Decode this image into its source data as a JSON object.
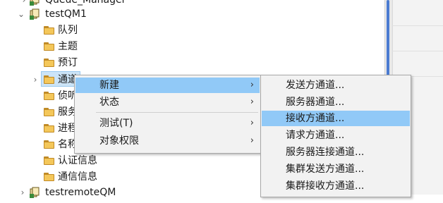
{
  "tree": {
    "nodes": [
      {
        "label": "Queue_Manager",
        "type": "qm",
        "expanded": false
      },
      {
        "label": "testQM1",
        "type": "qm",
        "expanded": true
      },
      {
        "label": "队列",
        "type": "folder"
      },
      {
        "label": "主题",
        "type": "folder"
      },
      {
        "label": "预订",
        "type": "folder"
      },
      {
        "label": "通道",
        "type": "folder",
        "selected": true
      },
      {
        "label": "侦听",
        "type": "folder"
      },
      {
        "label": "服务",
        "type": "folder"
      },
      {
        "label": "进程",
        "type": "folder"
      },
      {
        "label": "名称",
        "type": "folder"
      },
      {
        "label": "认证信息",
        "type": "folder"
      },
      {
        "label": "通信信息",
        "type": "folder"
      },
      {
        "label": "testremoteQM",
        "type": "qm",
        "expanded": false
      }
    ]
  },
  "context_menu": {
    "items": [
      {
        "label": "新建",
        "has_submenu": true,
        "highlighted": true
      },
      {
        "label": "状态",
        "has_submenu": true
      },
      {
        "label": "测试(T)",
        "has_submenu": true
      },
      {
        "label": "对象权限",
        "has_submenu": true
      }
    ],
    "arrow_glyph": "›"
  },
  "submenu": {
    "items": [
      {
        "label": "发送方通道..."
      },
      {
        "label": "服务器通道..."
      },
      {
        "label": "接收方通道...",
        "highlighted": true
      },
      {
        "label": "请求方通道..."
      },
      {
        "label": "服务器连接通道..."
      },
      {
        "label": "集群发送方通道..."
      },
      {
        "label": "集群接收方通道..."
      }
    ]
  },
  "colors": {
    "highlight": "#91c9f7",
    "selection": "#cce4f7",
    "scroll_thumb": "#4b7bd1",
    "folder": "#f4c75a"
  },
  "icons": {
    "expand": "chevron-right-icon",
    "collapse": "chevron-down-icon",
    "folder": "folder-icon",
    "queue_manager": "queue-manager-icon"
  }
}
